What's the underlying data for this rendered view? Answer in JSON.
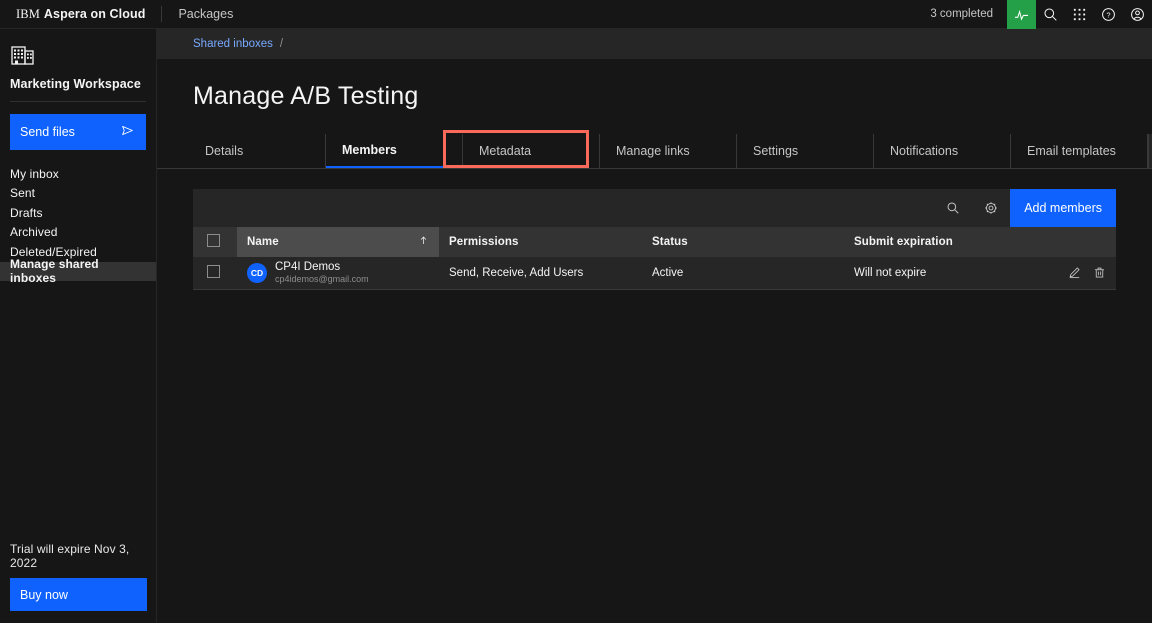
{
  "header": {
    "brand_prefix": "IBM",
    "brand_name": "Aspera on Cloud",
    "packages_label": "Packages",
    "completed_text": "3 completed",
    "icons": {
      "activity": "activity-icon",
      "search": "search-icon",
      "apps": "apps-grid-icon",
      "help": "help-icon",
      "account": "user-avatar-icon"
    },
    "accent_green": "#24a148"
  },
  "sidebar": {
    "workspace_icon": "building-icon",
    "workspace_title": "Marketing Workspace",
    "send_files_label": "Send files",
    "send_files_icon": "send-icon",
    "nav_items": [
      {
        "label": "My inbox",
        "active": false
      },
      {
        "label": "Sent",
        "active": false
      },
      {
        "label": "Drafts",
        "active": false
      },
      {
        "label": "Archived",
        "active": false
      },
      {
        "label": "Deleted/Expired",
        "active": false
      },
      {
        "label": "Manage shared inboxes",
        "active": true
      }
    ],
    "trial_text": "Trial will expire Nov 3, 2022",
    "buy_now_label": "Buy now",
    "accent_blue": "#0f62fe"
  },
  "main": {
    "breadcrumb": {
      "link": "Shared inboxes",
      "separator": "/"
    },
    "page_title": "Manage A/B Testing",
    "tabs": [
      {
        "label": "Details",
        "active": false
      },
      {
        "label": "Members",
        "active": true
      },
      {
        "label": "Metadata",
        "active": false
      },
      {
        "label": "Manage links",
        "active": false
      },
      {
        "label": "Settings",
        "active": false
      },
      {
        "label": "Notifications",
        "active": false
      },
      {
        "label": "Email templates",
        "active": false
      }
    ],
    "tab_scroll_icon": "chevron-right-icon",
    "annotation_color": "#fa6a5a",
    "toolbar": {
      "search_icon": "search-icon",
      "settings_icon": "gear-icon",
      "add_members_label": "Add members"
    },
    "table": {
      "columns": [
        {
          "key": "check",
          "label": ""
        },
        {
          "key": "name",
          "label": "Name",
          "sorted": true,
          "sort_icon": "sort-arrow-up-icon"
        },
        {
          "key": "permissions",
          "label": "Permissions",
          "sorted": false
        },
        {
          "key": "status",
          "label": "Status",
          "sorted": false
        },
        {
          "key": "expiration",
          "label": "Submit expiration",
          "sorted": false
        },
        {
          "key": "actions",
          "label": ""
        }
      ],
      "rows": [
        {
          "avatar_initials": "CD",
          "name": "CP4I Demos",
          "email": "cp4idemos@gmail.com",
          "permissions": "Send, Receive, Add Users",
          "status": "Active",
          "expiration": "Will not expire",
          "edit_icon": "edit-pencil-icon",
          "delete_icon": "trash-icon"
        }
      ]
    }
  }
}
